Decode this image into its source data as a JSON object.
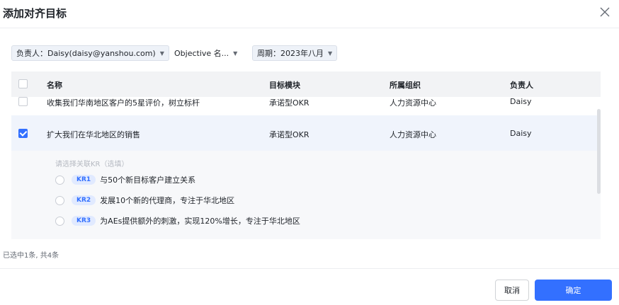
{
  "dialog": {
    "title": "添加对齐目标"
  },
  "filters": {
    "owner": "负责人：Daisy(daisy@yanshou.com)",
    "objective": "Objective 名...",
    "period": "周期：2023年八月"
  },
  "table": {
    "headers": [
      "名称",
      "目标模块",
      "所属组织",
      "负责人"
    ],
    "rows": [
      {
        "name": "收集我们华南地区客户的5星评价，树立标杆",
        "module": "承诺型OKR",
        "org": "人力资源中心",
        "owner": "Daisy",
        "checked": false
      },
      {
        "name": "扩大我们在华北地区的销售",
        "module": "承诺型OKR",
        "org": "人力资源中心",
        "owner": "Daisy",
        "checked": true
      }
    ],
    "kr_hint": "请选择关联KR（选填）",
    "krs": [
      {
        "tag": "KR1",
        "text": "与50个新目标客户建立关系"
      },
      {
        "tag": "KR2",
        "text": "发展10个新的代理商，专注于华北地区"
      },
      {
        "tag": "KR3",
        "text": "为AEs提供额外的刺激，实现120%增长，专注于华北地区"
      }
    ]
  },
  "footer": {
    "selected_text": "已选中1条, 共4条",
    "cancel_label": "取消",
    "ok_label": "确定"
  },
  "colors": {
    "primary": "#3370ff",
    "selected_row": "#f0f4fc"
  }
}
